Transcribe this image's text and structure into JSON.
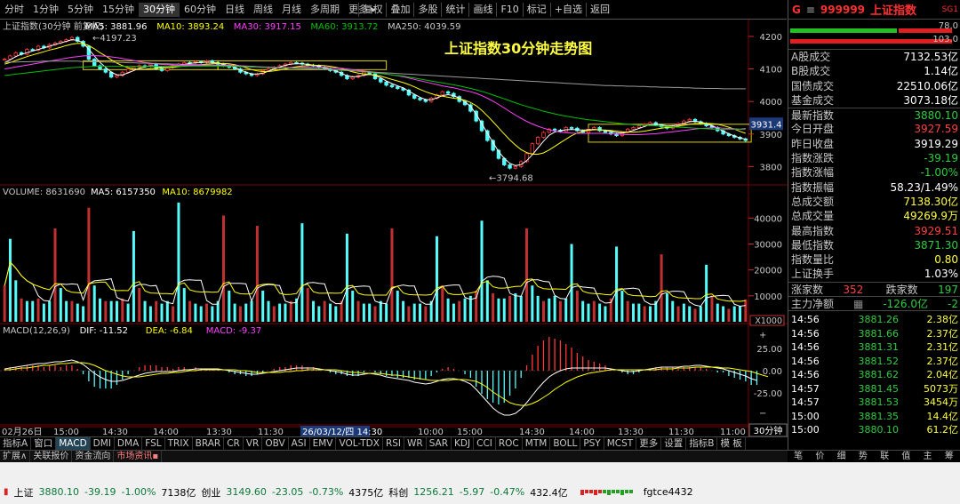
{
  "toolbar": {
    "periods": [
      "分时",
      "1分钟",
      "5分钟",
      "15分钟",
      "30分钟",
      "60分钟",
      "日线",
      "周线",
      "月线",
      "多周期",
      "更多 ▸"
    ],
    "active_period": "30分钟",
    "buttons": [
      "复权",
      "叠加",
      "多股",
      "统计",
      "画线",
      "F10",
      "标记",
      "+自选",
      "返回"
    ]
  },
  "chart_data": {
    "type": "line",
    "title": "上证指数30分钟走势图",
    "price_header": {
      "name": "上证指数(30分钟 前复权)",
      "ma5": "MA5: 3881.96",
      "ma10": "MA10: 3893.24",
      "ma30": "MA30: 3917.15",
      "ma60": "MA60: 3913.72",
      "ma250": "MA250: 4039.59"
    },
    "price_axis": [
      "4200",
      "4100",
      "4000",
      "3900",
      "3800"
    ],
    "price_ylim": [
      3760,
      4230
    ],
    "high_label": "4197.23",
    "low_label": "3794.68",
    "current_price_tag": "3931.4",
    "price_series": [
      4130,
      4140,
      4150,
      4145,
      4160,
      4158,
      4170,
      4165,
      4175,
      4180,
      4185,
      4190,
      4197,
      4185,
      4170,
      4130,
      4110,
      4100,
      4090,
      4075,
      4080,
      4090,
      4100,
      4105,
      4110,
      4108,
      4115,
      4100,
      4095,
      4105,
      4110,
      4115,
      4120,
      4118,
      4122,
      4120,
      4125,
      4120,
      4115,
      4110,
      4105,
      4100,
      4090,
      4085,
      4080,
      4085,
      4095,
      4100,
      4105,
      4110,
      4115,
      4120,
      4118,
      4115,
      4112,
      4110,
      4105,
      4100,
      4095,
      4090,
      4080,
      4070,
      4075,
      4080,
      4090,
      4085,
      4070,
      4060,
      4050,
      4045,
      4040,
      4035,
      4020,
      4010,
      4005,
      4000,
      4010,
      4020,
      4030,
      4025,
      4015,
      4000,
      3990,
      3970,
      3940,
      3910,
      3880,
      3850,
      3825,
      3805,
      3795,
      3800,
      3815,
      3840,
      3870,
      3890,
      3905,
      3915,
      3912,
      3908,
      3920,
      3918,
      3910,
      3905,
      3915,
      3920,
      3910,
      3905,
      3900,
      3895,
      3905,
      3915,
      3920,
      3925,
      3930,
      3935,
      3928,
      3922,
      3918,
      3925,
      3932,
      3940,
      3945,
      3938,
      3932,
      3925,
      3920,
      3910,
      3900,
      3895,
      3890,
      3885,
      3880
    ],
    "ma5_series": [
      4120,
      4128,
      4138,
      4145,
      4150,
      4155,
      4160,
      4165,
      4170,
      4175,
      4180,
      4185,
      4190,
      4188,
      4180,
      4160,
      4140,
      4120,
      4105,
      4090,
      4082,
      4082,
      4088,
      4095,
      4102,
      4106,
      4110,
      4108,
      4105,
      4104,
      4106,
      4110,
      4114,
      4117,
      4119,
      4120,
      4121,
      4120,
      4118,
      4114,
      4110,
      4105,
      4097,
      4090,
      4085,
      4084,
      4087,
      4093,
      4100,
      4106,
      4111,
      4115,
      4116,
      4116,
      4114,
      4112,
      4108,
      4104,
      4099,
      4094,
      4087,
      4079,
      4076,
      4077,
      4081,
      4083,
      4080,
      4073,
      4063,
      4055,
      4048,
      4042,
      4032,
      4022,
      4013,
      4006,
      4005,
      4011,
      4018,
      4021,
      4018,
      4010,
      3999,
      3985,
      3961,
      3932,
      3903,
      3874,
      3846,
      3825,
      3810,
      3803,
      3806,
      3818,
      3836,
      3857,
      3878,
      3896,
      3906,
      3910,
      3913,
      3914,
      3913,
      3912,
      3913,
      3914,
      3913,
      3911,
      3908,
      3904,
      3903,
      3906,
      3911,
      3917,
      3923,
      3929,
      3930,
      3928,
      3925,
      3925,
      3928,
      3933,
      3938,
      3939,
      3937,
      3932,
      3926,
      3918,
      3909,
      3901,
      3894,
      3888,
      3884
    ],
    "ma10_series": [
      4115,
      4120,
      4126,
      4132,
      4138,
      4143,
      4148,
      4153,
      4158,
      4162,
      4167,
      4172,
      4176,
      4179,
      4178,
      4172,
      4162,
      4150,
      4140,
      4128,
      4118,
      4110,
      4104,
      4100,
      4099,
      4099,
      4101,
      4102,
      4103,
      4104,
      4105,
      4107,
      4109,
      4111,
      4112,
      4113,
      4115,
      4116,
      4117,
      4117,
      4116,
      4113,
      4109,
      4104,
      4098,
      4094,
      4092,
      4092,
      4094,
      4097,
      4100,
      4104,
      4107,
      4109,
      4110,
      4111,
      4111,
      4110,
      4108,
      4105,
      4101,
      4096,
      4091,
      4087,
      4085,
      4083,
      4081,
      4078,
      4073,
      4068,
      4063,
      4058,
      4052,
      4045,
      4037,
      4030,
      4024,
      4019,
      4016,
      4013,
      4010,
      4008,
      4004,
      3997,
      3987,
      3973,
      3956,
      3938,
      3919,
      3900,
      3882,
      3866,
      3852,
      3843,
      3838,
      3838,
      3842,
      3851,
      3862,
      3873,
      3884,
      3895,
      3903,
      3908,
      3911,
      3913,
      3913,
      3912,
      3911,
      3909,
      3907,
      3906,
      3906,
      3907,
      3909,
      3912,
      3915,
      3918,
      3920,
      3921,
      3924,
      3927,
      3930,
      3932,
      3933,
      3933,
      3932,
      3930,
      3926,
      3921,
      3915,
      3908,
      3902
    ],
    "ma30_series": [
      4100,
      4103,
      4106,
      4109,
      4112,
      4115,
      4118,
      4121,
      4124,
      4127,
      4130,
      4133,
      4136,
      4138,
      4140,
      4141,
      4141,
      4140,
      4139,
      4137,
      4135,
      4132,
      4129,
      4126,
      4123,
      4120,
      4118,
      4116,
      4114,
      4113,
      4112,
      4111,
      4111,
      4111,
      4111,
      4111,
      4111,
      4112,
      4112,
      4112,
      4112,
      4111,
      4110,
      4109,
      4108,
      4107,
      4106,
      4105,
      4104,
      4104,
      4104,
      4104,
      4104,
      4105,
      4105,
      4105,
      4105,
      4105,
      4104,
      4103,
      4102,
      4100,
      4098,
      4096,
      4094,
      4092,
      4090,
      4088,
      4085,
      4082,
      4079,
      4076,
      4072,
      4068,
      4064,
      4060,
      4056,
      4052,
      4048,
      4045,
      4042,
      4038,
      4034,
      4030,
      4025,
      4018,
      4010,
      4001,
      3991,
      3980,
      3969,
      3958,
      3948,
      3939,
      3931,
      3924,
      3918,
      3913,
      3909,
      3906,
      3904,
      3903,
      3902,
      3902,
      3902,
      3902,
      3902,
      3902,
      3901,
      3900,
      3899,
      3898,
      3898,
      3898,
      3899,
      3900,
      3901,
      3903,
      3905,
      3907,
      3909,
      3911,
      3913,
      3915,
      3917,
      3918,
      3919,
      3919,
      3918,
      3917,
      3916,
      3915,
      3917
    ],
    "ma60_series": [
      4080,
      4082,
      4084,
      4086,
      4088,
      4090,
      4092,
      4094,
      4096,
      4098,
      4100,
      4102,
      4104,
      4105,
      4106,
      4107,
      4108,
      4108,
      4108,
      4108,
      4108,
      4108,
      4108,
      4108,
      4108,
      4108,
      4108,
      4108,
      4108,
      4108,
      4108,
      4108,
      4108,
      4108,
      4108,
      4108,
      4108,
      4108,
      4108,
      4108,
      4108,
      4108,
      4107,
      4107,
      4106,
      4106,
      4105,
      4105,
      4104,
      4104,
      4103,
      4103,
      4103,
      4102,
      4102,
      4101,
      4101,
      4100,
      4099,
      4098,
      4097,
      4096,
      4095,
      4093,
      4092,
      4090,
      4088,
      4086,
      4084,
      4082,
      4080,
      4078,
      4075,
      4072,
      4069,
      4066,
      4063,
      4060,
      4057,
      4054,
      4051,
      4048,
      4044,
      4040,
      4036,
      4031,
      4026,
      4020,
      4014,
      4008,
      4002,
      3996,
      3990,
      3985,
      3980,
      3975,
      3970,
      3966,
      3962,
      3958,
      3955,
      3952,
      3949,
      3946,
      3944,
      3942,
      3940,
      3938,
      3936,
      3934,
      3932,
      3930,
      3929,
      3928,
      3927,
      3926,
      3925,
      3924,
      3923,
      3922,
      3921,
      3920,
      3919,
      3918,
      3917,
      3916,
      3915,
      3915,
      3914,
      3914,
      3914,
      3914,
      3914
    ],
    "ma250_series": [
      4120,
      4121,
      4121,
      4122,
      4122,
      4123,
      4123,
      4124,
      4124,
      4124,
      4124,
      4124,
      4124,
      4124,
      4123,
      4123,
      4122,
      4122,
      4121,
      4121,
      4120,
      4120,
      4119,
      4119,
      4118,
      4118,
      4117,
      4117,
      4116,
      4116,
      4115,
      4115,
      4114,
      4114,
      4113,
      4113,
      4112,
      4112,
      4111,
      4111,
      4110,
      4110,
      4109,
      4108,
      4108,
      4107,
      4106,
      4106,
      4105,
      4104,
      4104,
      4103,
      4102,
      4102,
      4101,
      4100,
      4099,
      4099,
      4098,
      4097,
      4096,
      4095,
      4094,
      4093,
      4092,
      4091,
      4090,
      4089,
      4088,
      4087,
      4086,
      4085,
      4084,
      4083,
      4082,
      4081,
      4080,
      4079,
      4078,
      4077,
      4076,
      4075,
      4074,
      4073,
      4072,
      4071,
      4070,
      4069,
      4068,
      4067,
      4066,
      4065,
      4064,
      4063,
      4062,
      4061,
      4060,
      4059,
      4058,
      4057,
      4056,
      4055,
      4054,
      4053,
      4052,
      4051,
      4050,
      4049,
      4049,
      4048,
      4048,
      4047,
      4047,
      4046,
      4046,
      4045,
      4045,
      4044,
      4044,
      4043,
      4043,
      4042,
      4042,
      4041,
      4041,
      4040,
      4040,
      4040,
      4039,
      4039,
      4039,
      4039,
      4039
    ],
    "volume_header": {
      "name": "VOLUME: 8631690",
      "ma5": "MA5: 6157350",
      "ma10": "MA10: 8679982"
    },
    "volume_axis": [
      "40000",
      "30000",
      "20000",
      "10000"
    ],
    "volume_unit": "X1000",
    "volume_ylim": [
      0,
      48000
    ],
    "volume_series": [
      14000,
      32000,
      16000,
      9000,
      8000,
      8000,
      9000,
      7000,
      8000,
      36000,
      13000,
      8000,
      8000,
      7000,
      6000,
      44000,
      14000,
      9000,
      8000,
      8000,
      8000,
      9000,
      7000,
      35000,
      13000,
      8000,
      6000,
      8000,
      7000,
      8000,
      6000,
      46000,
      13000,
      8000,
      7000,
      6000,
      7000,
      6000,
      8000,
      41000,
      12000,
      7000,
      6000,
      7000,
      8000,
      37000,
      12000,
      8000,
      6000,
      7000,
      7000,
      8000,
      9000,
      38000,
      13000,
      8000,
      6000,
      8000,
      7000,
      6000,
      8000,
      34000,
      12000,
      8000,
      7000,
      7000,
      6000,
      8000,
      7000,
      36000,
      12000,
      8000,
      6000,
      7000,
      7000,
      6000,
      8000,
      33000,
      14000,
      9000,
      7000,
      8000,
      9000,
      10000,
      12000,
      39000,
      16000,
      11000,
      9000,
      9000,
      10000,
      11000,
      10000,
      36000,
      14000,
      10000,
      8000,
      9000,
      10000,
      8000,
      9000,
      30000,
      12000,
      8000,
      7000,
      8000,
      7000,
      6000,
      9000,
      29000,
      12000,
      8000,
      7000,
      7000,
      6000,
      6000,
      8000,
      26000,
      11000,
      8000,
      6000,
      7000,
      6000,
      5000,
      6000,
      22000,
      10000,
      7000,
      6000,
      5000,
      6000,
      6000,
      8600
    ],
    "volume_colors": "rc",
    "macd_header": {
      "name": "MACD(12,26,9)",
      "dif": "DIF: -11.52",
      "dea": "DEA: -6.84",
      "macd": "MACD: -9.37"
    },
    "macd_axis": [
      "25.00",
      "0.00",
      "-25.00"
    ],
    "macd_ylim": [
      -55,
      45
    ],
    "dif_series": [
      2,
      3,
      4,
      5,
      6,
      7,
      8,
      8,
      9,
      10,
      10,
      11,
      12,
      10,
      7,
      2,
      -3,
      -7,
      -10,
      -12,
      -12,
      -11,
      -9,
      -7,
      -5,
      -3,
      -2,
      -1,
      -1,
      -1,
      -1,
      0,
      1,
      1,
      2,
      2,
      2,
      2,
      2,
      1,
      0,
      -1,
      -2,
      -3,
      -4,
      -4,
      -3,
      -2,
      -1,
      0,
      1,
      2,
      3,
      3,
      3,
      3,
      2,
      1,
      0,
      -1,
      -2,
      -4,
      -5,
      -5,
      -4,
      -3,
      -4,
      -5,
      -7,
      -8,
      -9,
      -10,
      -11,
      -13,
      -14,
      -15,
      -14,
      -12,
      -10,
      -9,
      -9,
      -10,
      -12,
      -15,
      -21,
      -28,
      -35,
      -42,
      -47,
      -50,
      -50,
      -48,
      -43,
      -36,
      -28,
      -20,
      -13,
      -7,
      -3,
      0,
      2,
      3,
      3,
      3,
      3,
      3,
      3,
      3,
      2,
      1,
      0,
      -1,
      -1,
      0,
      1,
      2,
      3,
      4,
      4,
      4,
      4,
      5,
      5,
      6,
      6,
      5,
      4,
      3,
      2,
      0,
      -2,
      -4,
      -6,
      -9,
      -11
    ],
    "dea_series": [
      1,
      1,
      2,
      3,
      3,
      4,
      5,
      6,
      6,
      7,
      8,
      8,
      9,
      9,
      9,
      8,
      6,
      3,
      0,
      -2,
      -4,
      -6,
      -7,
      -7,
      -7,
      -6,
      -5,
      -4,
      -3,
      -3,
      -2,
      -2,
      -1,
      0,
      0,
      1,
      1,
      1,
      1,
      1,
      1,
      1,
      0,
      0,
      -1,
      -2,
      -2,
      -2,
      -2,
      -2,
      -1,
      -1,
      0,
      0,
      1,
      1,
      1,
      1,
      1,
      1,
      0,
      -1,
      -2,
      -2,
      -3,
      -3,
      -3,
      -3,
      -4,
      -5,
      -5,
      -6,
      -7,
      -8,
      -9,
      -10,
      -11,
      -11,
      -11,
      -11,
      -10,
      -10,
      -10,
      -11,
      -12,
      -15,
      -19,
      -24,
      -28,
      -32,
      -36,
      -38,
      -39,
      -39,
      -37,
      -34,
      -30,
      -26,
      -21,
      -17,
      -13,
      -10,
      -7,
      -5,
      -3,
      -2,
      -1,
      0,
      1,
      1,
      1,
      1,
      1,
      1,
      1,
      1,
      1,
      2,
      2,
      2,
      3,
      3,
      3,
      4,
      4,
      4,
      4,
      4,
      3,
      3,
      2,
      1,
      0,
      -1,
      -3,
      -5,
      -6.84
    ],
    "x_labels": [
      "02月26日",
      "15:00",
      "14:30",
      "14:00",
      "13:30",
      "11:30",
      "26/03/12/四 14:30",
      "10:00",
      "15:00",
      "14:30",
      "14:00",
      "13:30",
      "11:30",
      "11:00"
    ],
    "grid": false
  },
  "indicator_tabs": [
    "指标A",
    "窗口",
    "MACD",
    "DMI",
    "DMA",
    "FSL",
    "TRIX",
    "BRAR",
    "CR",
    "VR",
    "OBV",
    "ASI",
    "EMV",
    "VOL-TDX",
    "RSI",
    "WR",
    "SAR",
    "KDJ",
    "CCI",
    "ROC",
    "MTM",
    "BOLL",
    "PSY",
    "MCST",
    "更多",
    "设置",
    "指标B",
    "模 板"
  ],
  "active_indicator": "MACD",
  "bottom_tabs": [
    "扩展∧",
    "关联报价",
    "资金流向",
    "市场资讯▪"
  ],
  "period_label": "30分钟",
  "right_panel": {
    "code": "999999",
    "name": "上证指数",
    "tag": "SG1",
    "bar1": "78.0",
    "bar2": "103.0",
    "rows": [
      {
        "label": "A股成交",
        "value": "7132.53亿",
        "color": "#ffffff"
      },
      {
        "label": "B股成交",
        "value": "1.14亿",
        "color": "#ffffff"
      },
      {
        "label": "国债成交",
        "value": "22510.06亿",
        "color": "#ffffff"
      },
      {
        "label": "基金成交",
        "value": "3073.18亿",
        "color": "#ffffff"
      },
      {
        "label": "最新指数",
        "value": "3880.10",
        "color": "#2ecc40"
      },
      {
        "label": "今日开盘",
        "value": "3927.59",
        "color": "#ff4040"
      },
      {
        "label": "昨日收盘",
        "value": "3919.29",
        "color": "#ffffff"
      },
      {
        "label": "指数涨跌",
        "value": "-39.19",
        "color": "#2ecc40"
      },
      {
        "label": "指数涨幅",
        "value": "-1.00%",
        "color": "#2ecc40"
      },
      {
        "label": "指数振幅",
        "value": "58.23/1.49%",
        "color": "#ffffff"
      },
      {
        "label": "总成交额",
        "value": "7138.30亿",
        "color": "#ffff40"
      },
      {
        "label": "总成交量",
        "value": "49269.9万",
        "color": "#ffff40"
      },
      {
        "label": "最高指数",
        "value": "3929.51",
        "color": "#ff4040"
      },
      {
        "label": "最低指数",
        "value": "3871.30",
        "color": "#2ecc40"
      },
      {
        "label": "指数量比",
        "value": "0.80",
        "color": "#ffff40"
      },
      {
        "label": "上证换手",
        "value": "1.03%",
        "color": "#ffffff"
      }
    ],
    "up_label": "涨家数",
    "up_value": "352",
    "down_label": "跌家数",
    "down_value": "197",
    "main_label": "主力净额",
    "main_value": "-126.0亿",
    "main_value2": "-2",
    "trades": [
      {
        "t": "14:56",
        "p": "3881.26",
        "v": "2.38亿"
      },
      {
        "t": "14:56",
        "p": "3881.66",
        "v": "2.37亿"
      },
      {
        "t": "14:56",
        "p": "3881.31",
        "v": "2.31亿"
      },
      {
        "t": "14:56",
        "p": "3881.52",
        "v": "2.37亿"
      },
      {
        "t": "14:56",
        "p": "3881.62",
        "v": "2.04亿"
      },
      {
        "t": "14:57",
        "p": "3881.45",
        "v": "5073万"
      },
      {
        "t": "14:57",
        "p": "3881.53",
        "v": "3454万"
      },
      {
        "t": "15:00",
        "p": "3881.35",
        "v": "14.4亿"
      },
      {
        "t": "15:00",
        "p": "3880.10",
        "v": "61.2亿"
      }
    ],
    "tabs": [
      "笔",
      "价",
      "细",
      "势",
      "联",
      "值",
      "主",
      "筹"
    ]
  },
  "statusbar": {
    "items": [
      {
        "name": "上证",
        "price": "3880.10",
        "chg": "-39.19",
        "pct": "-1.00%",
        "vol": "7138亿"
      },
      {
        "name": "创业",
        "price": "3149.60",
        "chg": "-23.05",
        "pct": "-0.73%",
        "vol": "4375亿"
      },
      {
        "name": "科创",
        "price": "1256.21",
        "chg": "-5.97",
        "pct": "-0.47%",
        "vol": "432.4亿"
      }
    ],
    "extra": "fgtce4432"
  }
}
